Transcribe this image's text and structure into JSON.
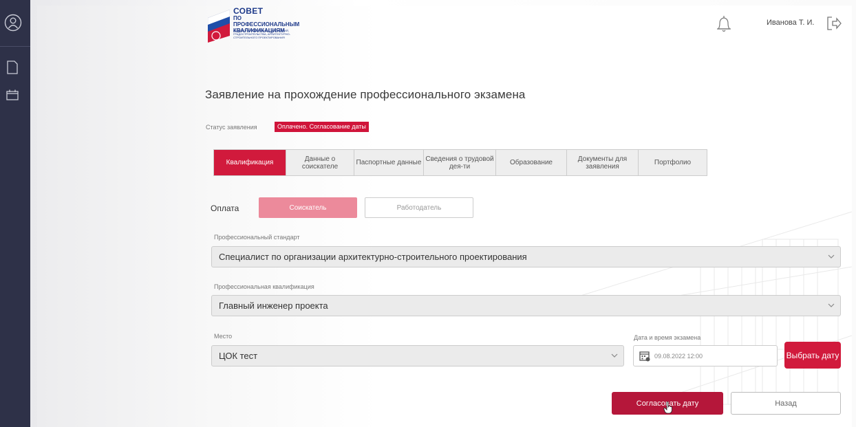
{
  "sidebar": {
    "icons": [
      "user-circle-icon",
      "document-icon",
      "calendar-icon"
    ]
  },
  "header": {
    "logo": {
      "title": "СОВЕТ",
      "subtitle": "ПО ПРОФЕССИОНАЛЬНЫМ КВАЛИФИКАЦИЯМ",
      "tiny": "В ОБЛАСТИ ИНЖЕНЕРНЫХ ИЗЫСКАНИЙ, ГРАДОСТРОИТЕЛЬСТВА, АРХИТЕКТУРНО-СТРОИТЕЛЬНОГО ПРОЕКТИРОВАНИЯ"
    },
    "username": "Иванова Т. И.",
    "bell_icon": "bell-icon",
    "logout_icon": "logout-icon"
  },
  "page": {
    "title": "Заявление на прохождение профессионального экзамена",
    "status_label": "Статус заявления",
    "status_value": "Оплачено. Согласование даты"
  },
  "tabs": [
    {
      "label": "Квалификация",
      "active": true
    },
    {
      "label": "Данные о соискателе",
      "active": false
    },
    {
      "label": "Паспортные данные",
      "active": false
    },
    {
      "label": "Сведения о трудовой дея-ти",
      "active": false
    },
    {
      "label": "Образование",
      "active": false
    },
    {
      "label": "Документы для заявления",
      "active": false
    },
    {
      "label": "Портфолио",
      "active": false
    }
  ],
  "payment": {
    "label": "Оплата",
    "option_a": "Соискатель",
    "option_b": "Работодатель",
    "selected": "Соискатель"
  },
  "standard": {
    "label": "Профессиональный стандарт",
    "value": "Специалист по организации архитектурно-строительного проектирования"
  },
  "qualification": {
    "label": "Профессиональная квалификация",
    "value": "Главный инженер проекта"
  },
  "place": {
    "label": "Место",
    "value": "ЦОК тест"
  },
  "exam_date": {
    "label": "Дата и время экзамена",
    "value": "09.08.2022 12:00",
    "pick_button": "Выбрать дату"
  },
  "actions": {
    "agree": "Согласовать дату",
    "back": "Назад"
  },
  "colors": {
    "accent": "#d11a3c",
    "sidebar": "#2e3148",
    "agree": "#b5173a"
  }
}
